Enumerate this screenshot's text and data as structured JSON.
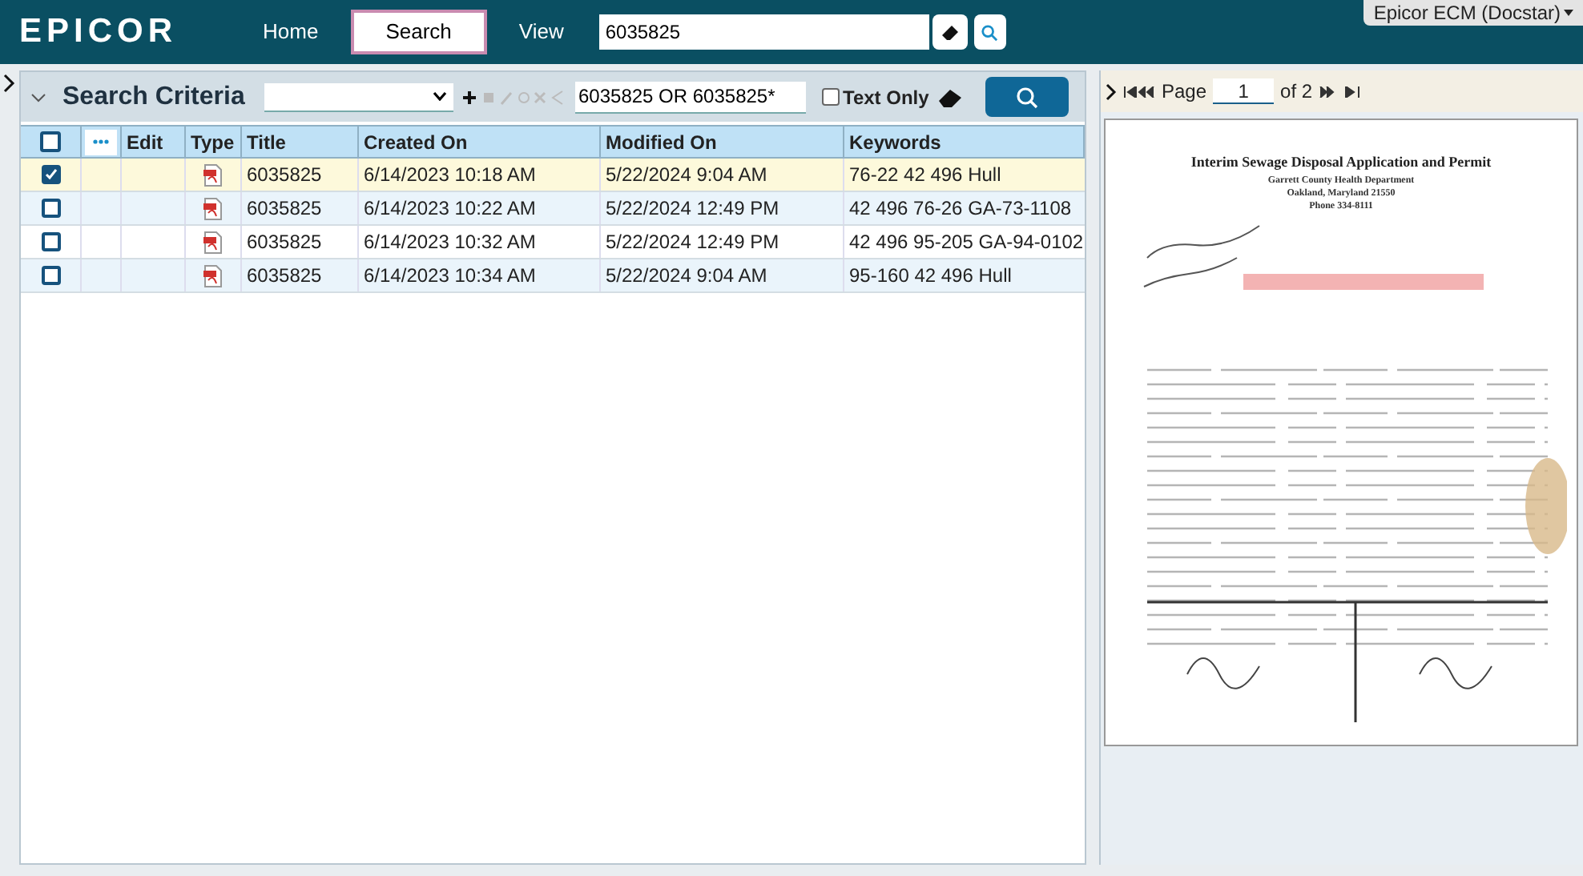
{
  "header": {
    "logo": "EPICOR",
    "nav": [
      {
        "label": "Home",
        "selected": false
      },
      {
        "label": "Search",
        "selected": true
      },
      {
        "label": "View",
        "selected": false
      }
    ],
    "search_value": "6035825",
    "account": "Epicor ECM (Docstar)"
  },
  "search_panel": {
    "title": "Search Criteria",
    "query": "6035825 OR 6035825*",
    "text_only": {
      "label": "Text Only",
      "checked": false
    }
  },
  "table": {
    "select_all": {
      "checked": false
    },
    "columns": [
      "Edit",
      "Type",
      "Title",
      "Created On",
      "Modified On",
      "Keywords"
    ],
    "rows": [
      {
        "selected": true,
        "title": "6035825",
        "created": "6/14/2023 10:18 AM",
        "modified": "5/22/2024 9:04 AM",
        "keywords": "76-22 42 496 Hull"
      },
      {
        "selected": false,
        "title": "6035825",
        "created": "6/14/2023 10:22 AM",
        "modified": "5/22/2024 12:49 PM",
        "keywords": "42 496 76-26 GA-73-1108"
      },
      {
        "selected": false,
        "title": "6035825",
        "created": "6/14/2023 10:32 AM",
        "modified": "5/22/2024 12:49 PM",
        "keywords": "42 496 95-205 GA-94-0102"
      },
      {
        "selected": false,
        "title": "6035825",
        "created": "6/14/2023 10:34 AM",
        "modified": "5/22/2024 9:04 AM",
        "keywords": "95-160 42 496 Hull"
      }
    ]
  },
  "viewer": {
    "page_label": "Page",
    "page": "1",
    "page_count": "of 2",
    "document": {
      "title": "Interim Sewage Disposal Application and Permit",
      "header_lines": [
        "Garrett County Health Department",
        "Oakland, Maryland 21550",
        "Phone 334-8111"
      ]
    }
  }
}
